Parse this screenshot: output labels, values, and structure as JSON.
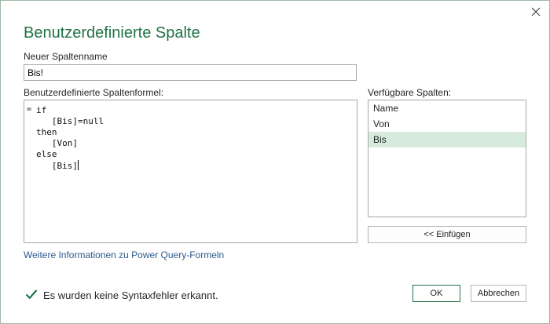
{
  "dialog": {
    "title": "Benutzerdefinierte Spalte",
    "close_icon": "close-icon"
  },
  "column_name": {
    "label": "Neuer Spaltenname",
    "value": "Bis!"
  },
  "formula": {
    "label": "Benutzerdefinierte Spaltenformel:",
    "prefix": "=",
    "code": "if\n   [Bis]=null\nthen\n   [Von]\nelse\n   [Bis]"
  },
  "available_columns": {
    "label": "Verfügbare Spalten:",
    "items": [
      "Name",
      "Von",
      "Bis"
    ],
    "selected": "Bis",
    "insert_label": "<< Einfügen"
  },
  "help_link": "Weitere Informationen zu Power Query-Formeln",
  "status": {
    "icon": "checkmark-icon",
    "text": "Es wurden keine Syntaxfehler erkannt."
  },
  "buttons": {
    "ok": "OK",
    "cancel": "Abbrechen"
  },
  "colors": {
    "accent": "#217346",
    "selection": "#d6ebdc",
    "link": "#2a5a8c"
  }
}
